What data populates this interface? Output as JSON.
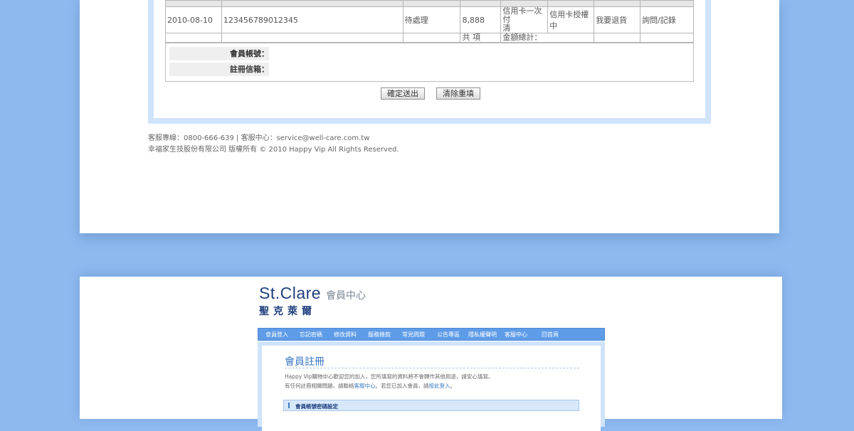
{
  "order_table": {
    "row": {
      "date": "2010-08-10",
      "order_no": "123456789012345",
      "status": "待處理",
      "amount": "8,888",
      "payment_line1": "信用卡一次付",
      "payment_line2": "清",
      "pay_status": "信用卡授權中",
      "return_action": "我要退貨",
      "detail_action": "詢問/記錄"
    },
    "summary": {
      "count_label": "共 項",
      "total_label": "金額總計："
    }
  },
  "member_info": {
    "account_label": "會員帳號：",
    "email_label": "註冊信箱："
  },
  "buttons": {
    "submit": "確定送出",
    "reset": "清除重填"
  },
  "footer": {
    "line1": "客服專線：0800-666-639 | 客服中心：service@well-care.com.tw",
    "line2": "幸福家生技股份有限公司 版權所有 © 2010 Happy Vip All Rights Reserved."
  },
  "brand": {
    "name_en": "St.Clare",
    "subtitle": "會員中心",
    "name_cn": "聖克萊爾"
  },
  "nav": {
    "items": [
      {
        "label": "會員登入"
      },
      {
        "label": "忘記密碼"
      },
      {
        "label": "修改資料"
      },
      {
        "label": "服務條款"
      },
      {
        "label": "常見問題"
      },
      {
        "label": "公告專區"
      },
      {
        "label": "隱私權聲明"
      },
      {
        "label": "客服中心"
      },
      {
        "label": "回首頁"
      }
    ]
  },
  "register": {
    "title": "會員註冊",
    "line1": "Happy Vip購物中心歡迎您的加入，您所填寫的資料將不會轉作其他用途，請安心填寫。",
    "line2_pre": "有任何註冊相關問題，請聯絡",
    "line2_link1": "客服中心",
    "line2_mid": "。若您已加入會員，請",
    "line2_link2": "按此登入",
    "line2_post": "。",
    "section_title": "會員帳號密碼設定"
  },
  "colors": {
    "background": "#8db9ef",
    "accent": "#3a78c2",
    "nav_bg": "#5e9ce8",
    "frame": "#cfe3fb",
    "brand": "#1f3f7d"
  }
}
